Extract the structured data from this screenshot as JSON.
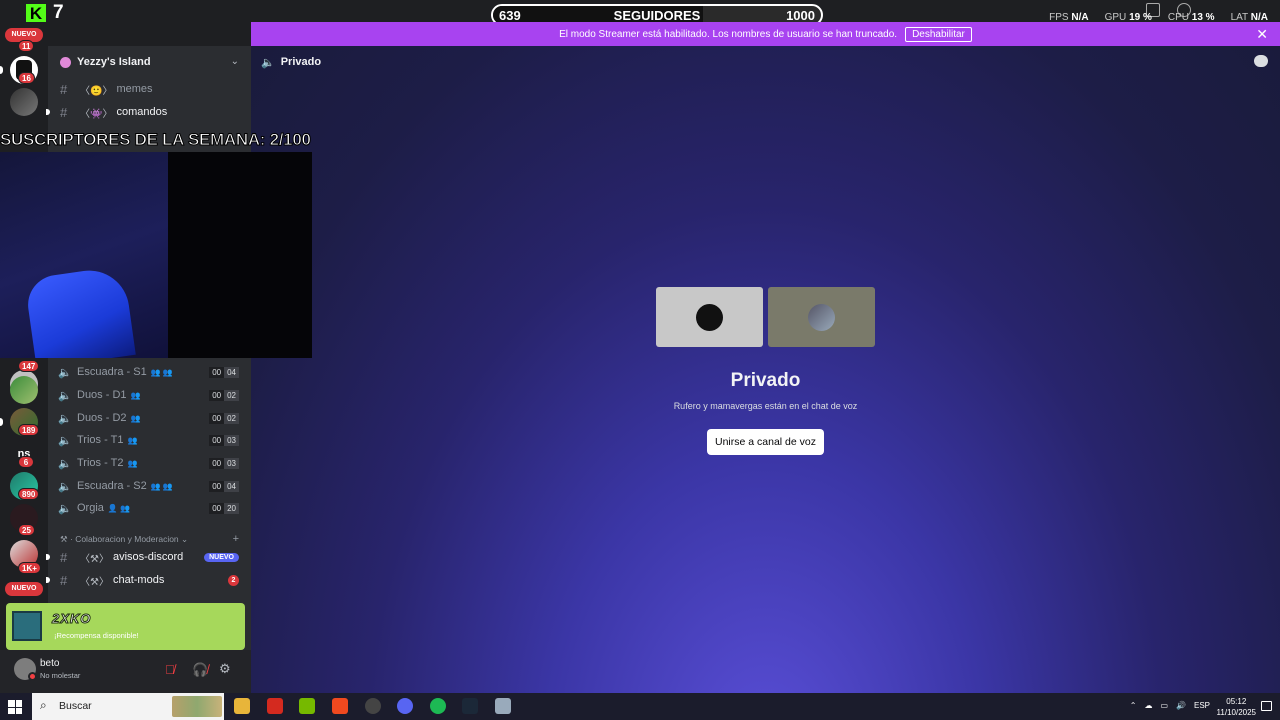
{
  "overlay": {
    "kick_count": "7",
    "follow_goal": {
      "current": "639",
      "label": "SEGUIDORES",
      "target": "1000",
      "progress": 0.639
    },
    "stats": [
      {
        "label": "FPS",
        "value": "N/A"
      },
      {
        "label": "GPU",
        "value": "19 %"
      },
      {
        "label": "CPU",
        "value": "13 %"
      },
      {
        "label": "LAT",
        "value": "N/A"
      }
    ],
    "subscribers_text": "SUSCRIPTORES DE LA SEMANA: 2/100"
  },
  "banner": {
    "text": "El modo Streamer está habilitado. Los nombres de usuario se han truncado.",
    "button": "Deshabilitar",
    "color": "#a843f0"
  },
  "rail": {
    "new_label": "NUEVO",
    "badges": [
      "11",
      "16",
      "147",
      "189",
      "6",
      "890",
      "25",
      "1K+"
    ],
    "text_server": "ns",
    "bottom_new_label": "NUEVO"
  },
  "sidebar": {
    "guild_name": "Yezzy's Island",
    "text_channels": [
      {
        "prefix": "〈🙂〉",
        "name": "memes"
      },
      {
        "prefix": "〈👾〉",
        "name": "comandos"
      }
    ],
    "voice_channels": [
      {
        "name": "Escuadra - S1",
        "count_a": "00",
        "count_b": "04"
      },
      {
        "name": "Duos - D1",
        "count_a": "00",
        "count_b": "02"
      },
      {
        "name": "Duos - D2",
        "count_a": "00",
        "count_b": "02"
      },
      {
        "name": "Trios - T1",
        "count_a": "00",
        "count_b": "03"
      },
      {
        "name": "Trios - T2",
        "count_a": "00",
        "count_b": "03"
      },
      {
        "name": "Escuadra - S2",
        "count_a": "00",
        "count_b": "04"
      },
      {
        "name": "Orgia",
        "count_a": "00",
        "count_b": "20"
      }
    ],
    "category": "Colaboracion y Moderacion",
    "mod_channels": [
      {
        "prefix": "〈⚒〉",
        "name": "avisos-discord",
        "tag": "NUEVO"
      },
      {
        "prefix": "〈⚒〉",
        "name": "chat-mods",
        "mentions": "2"
      }
    ]
  },
  "promo": {
    "logo": "2XKO",
    "text": "¡Recompensa disponible!",
    "color": "#a6d85b"
  },
  "user": {
    "name": "beto",
    "status": "No molestar"
  },
  "main": {
    "channel_name": "Privado",
    "title": "Privado",
    "subtitle": "Rufero y mamavergas están en el chat de voz",
    "join_button": "Unirse a canal de voz"
  },
  "taskbar": {
    "search_placeholder": "Buscar",
    "language": "ESP",
    "time": "05:12",
    "date": "11/10/2025"
  }
}
